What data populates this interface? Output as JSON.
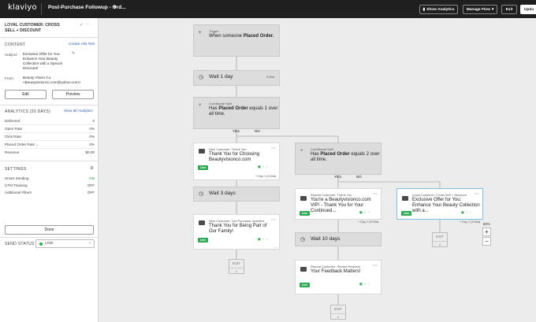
{
  "topbar": {
    "logo": "klaviyo",
    "flow_title": "Post-Purchase Followup - Ord...",
    "show_analytics": "Show Analytics",
    "manage_flow": "Manage Flow",
    "exit": "Exit",
    "update": "Upda"
  },
  "sidebar": {
    "title": "LOYAL CUSTOMER: CROSS SELL + DISCOUNT",
    "content_heading": "CONTENT",
    "create_ab_test": "Create A/B Test",
    "subject_label": "Subject:",
    "subject_value": "Exclusive Offer for You: Enhance Your Beauty Collection with a Special Discount!",
    "from_label": "From:",
    "from_name": "Beauty Vision Co.",
    "from_email": "<Beautyvisionco.com@yahoo.com>",
    "edit": "Edit",
    "preview": "Preview",
    "analytics_heading": "ANALYTICS (30 DAYS)",
    "view_all_analytics": "View all Analytics",
    "analytics": [
      {
        "label": "Delivered",
        "value": "0"
      },
      {
        "label": "Open Rate",
        "value": "0%"
      },
      {
        "label": "Click Rate",
        "value": "0%"
      },
      {
        "label": "Placed Order Rate ⌄",
        "value": "0%"
      },
      {
        "label": "Revenue",
        "value": "$0.00"
      }
    ],
    "settings_heading": "SETTINGS",
    "settings": [
      {
        "label": "Smart Sending",
        "value": "ON",
        "on": true
      },
      {
        "label": "UTM Tracking",
        "value": "OFF",
        "on": false
      },
      {
        "label": "Additional Filters",
        "value": "OFF",
        "on": false
      }
    ],
    "done": "Done",
    "send_status_label": "SEND STATUS",
    "send_status_value": "LIVE"
  },
  "canvas": {
    "trigger": {
      "kicker": "Trigger",
      "prefix": "When someone",
      "event": "Placed Order."
    },
    "wait1": {
      "text": "Wait 1 day",
      "time": "9:00a"
    },
    "split1": {
      "kicker": "Conditional Split",
      "prefix": "Has",
      "event": "Placed Order",
      "suffix": "equals 1 over all time."
    },
    "yes": "YES",
    "no": "NO",
    "email1": {
      "kicker": "New Customer: Thank You",
      "text": "Thank You for Choosing Beautyvisionco.com",
      "live": "Live",
      "day": "+ Day 1 (9:00a)"
    },
    "wait2": {
      "text": "Wait 3 days"
    },
    "email2": {
      "kicker": "New Customer: 2nd Purchase Incentive",
      "text": "Thank You for Being Part of Our Family!",
      "live": "Live"
    },
    "split2": {
      "kicker": "Conditional Split",
      "prefix": "Has",
      "event": "Placed Order",
      "suffix": "equals 2 over all time."
    },
    "email3": {
      "kicker": "Repeat Customer: Thank You",
      "text": "You're a Beautyvisionco.com VIP! - Thank You for Your Continued...",
      "live": "Live",
      "day": "+ Day 1 (9:00a)"
    },
    "email4": {
      "kicker": "Loyal Customer: Cross-Sell + Discount",
      "text": "Exclusive Offer for You: Enhance Your Beauty Collection with a...",
      "live": "Live",
      "day": "+ Day 1 (9:00a)"
    },
    "wait3": {
      "text": "Wait 10 days"
    },
    "email5": {
      "kicker": "Repeat Customer: Review Request",
      "text": "Your Feedback Matters!",
      "live": "Live"
    },
    "exit_label": "EXIT",
    "zoom": "80%",
    "zoom_in": "+",
    "zoom_out": "−"
  },
  "colors": {
    "accent_green": "#2dab53",
    "link_blue": "#2a5db0",
    "selected_border": "#7ec0e8",
    "topbar": "#1f1f1f"
  },
  "icons": [
    "plus-icon",
    "clock-icon",
    "split-icon",
    "mail-icon",
    "chart-icon",
    "ellipsis-icon",
    "check-icon",
    "pencil-icon",
    "gear-icon"
  ]
}
